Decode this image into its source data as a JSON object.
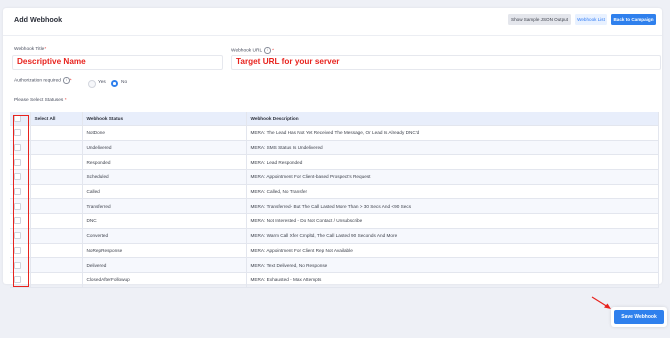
{
  "header": {
    "title": "Add Webhook",
    "btn_sample": "Show Sample JSON Output",
    "btn_list": "Webhook List",
    "btn_back": "Back to Campaign"
  },
  "form": {
    "title_label": "Webhook Title",
    "title_value": "Descriptive Name",
    "url_label": "Webhook URL",
    "url_value": "Target URL for your server",
    "auth_label": "Authorization required",
    "auth_yes": "Yes",
    "auth_no": "No",
    "auth_selected": "No",
    "statuses_label": "Please Select Statuses",
    "required_mark": "*"
  },
  "table": {
    "headers": [
      "Select All",
      "Webhook Status",
      "Webhook Description"
    ],
    "rows": [
      {
        "status": "NotDone",
        "desc": "MERA: The Lead Has Not Yet Received The Message, Or Lead Is Already DNC'd"
      },
      {
        "status": "Undelivered",
        "desc": "MERA: SMS Status Is Undelivered"
      },
      {
        "status": "Responded",
        "desc": "MERA: Lead Responded"
      },
      {
        "status": "Scheduled",
        "desc": "MERA: Appointment For Client-based Prospect's Request"
      },
      {
        "status": "Called",
        "desc": "MERA: Called, No Transfer"
      },
      {
        "status": "Transferred",
        "desc": "MERA: Transferred- But The Call Lasted More Than > 30 Secs And <90 Secs"
      },
      {
        "status": "DNC",
        "desc": "MERA: Not Interested - Do Not Contact / Unsubscribe"
      },
      {
        "status": "Converted",
        "desc": "MERA: Warm Call Xfer Cmpltd, The Call Lasted 90 Seconds And More"
      },
      {
        "status": "NoRepResponse",
        "desc": "MERA: Appointment For Client Rep Not Available"
      },
      {
        "status": "Delivered",
        "desc": "MERA: Text Delivered, No Response"
      },
      {
        "status": "ClosedAfterFollowup",
        "desc": "MERA: Exhausted - Max Attempts"
      }
    ]
  },
  "footer": {
    "save_label": "Save Webhook"
  },
  "colors": {
    "primary": "#2f80ed",
    "annotation_red": "#e8231e"
  }
}
